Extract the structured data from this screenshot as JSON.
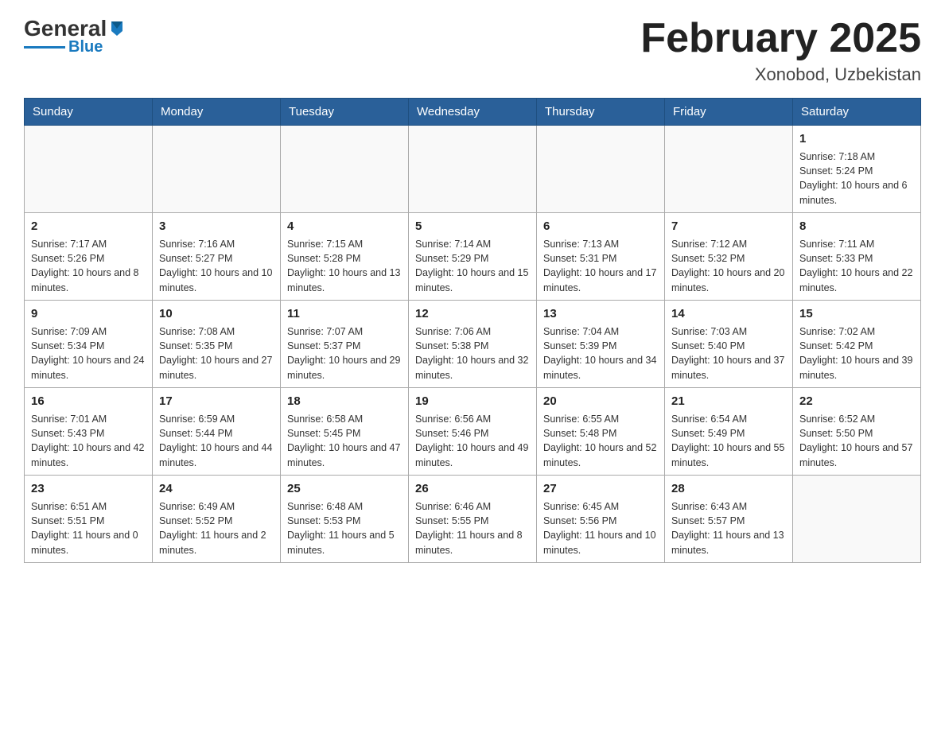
{
  "header": {
    "logo": {
      "general": "General",
      "arrow": "",
      "blue": "Blue"
    },
    "title": "February 2025",
    "subtitle": "Xonobod, Uzbekistan"
  },
  "weekdays": [
    "Sunday",
    "Monday",
    "Tuesday",
    "Wednesday",
    "Thursday",
    "Friday",
    "Saturday"
  ],
  "weeks": [
    [
      {
        "day": "",
        "info": ""
      },
      {
        "day": "",
        "info": ""
      },
      {
        "day": "",
        "info": ""
      },
      {
        "day": "",
        "info": ""
      },
      {
        "day": "",
        "info": ""
      },
      {
        "day": "",
        "info": ""
      },
      {
        "day": "1",
        "info": "Sunrise: 7:18 AM\nSunset: 5:24 PM\nDaylight: 10 hours and 6 minutes."
      }
    ],
    [
      {
        "day": "2",
        "info": "Sunrise: 7:17 AM\nSunset: 5:26 PM\nDaylight: 10 hours and 8 minutes."
      },
      {
        "day": "3",
        "info": "Sunrise: 7:16 AM\nSunset: 5:27 PM\nDaylight: 10 hours and 10 minutes."
      },
      {
        "day": "4",
        "info": "Sunrise: 7:15 AM\nSunset: 5:28 PM\nDaylight: 10 hours and 13 minutes."
      },
      {
        "day": "5",
        "info": "Sunrise: 7:14 AM\nSunset: 5:29 PM\nDaylight: 10 hours and 15 minutes."
      },
      {
        "day": "6",
        "info": "Sunrise: 7:13 AM\nSunset: 5:31 PM\nDaylight: 10 hours and 17 minutes."
      },
      {
        "day": "7",
        "info": "Sunrise: 7:12 AM\nSunset: 5:32 PM\nDaylight: 10 hours and 20 minutes."
      },
      {
        "day": "8",
        "info": "Sunrise: 7:11 AM\nSunset: 5:33 PM\nDaylight: 10 hours and 22 minutes."
      }
    ],
    [
      {
        "day": "9",
        "info": "Sunrise: 7:09 AM\nSunset: 5:34 PM\nDaylight: 10 hours and 24 minutes."
      },
      {
        "day": "10",
        "info": "Sunrise: 7:08 AM\nSunset: 5:35 PM\nDaylight: 10 hours and 27 minutes."
      },
      {
        "day": "11",
        "info": "Sunrise: 7:07 AM\nSunset: 5:37 PM\nDaylight: 10 hours and 29 minutes."
      },
      {
        "day": "12",
        "info": "Sunrise: 7:06 AM\nSunset: 5:38 PM\nDaylight: 10 hours and 32 minutes."
      },
      {
        "day": "13",
        "info": "Sunrise: 7:04 AM\nSunset: 5:39 PM\nDaylight: 10 hours and 34 minutes."
      },
      {
        "day": "14",
        "info": "Sunrise: 7:03 AM\nSunset: 5:40 PM\nDaylight: 10 hours and 37 minutes."
      },
      {
        "day": "15",
        "info": "Sunrise: 7:02 AM\nSunset: 5:42 PM\nDaylight: 10 hours and 39 minutes."
      }
    ],
    [
      {
        "day": "16",
        "info": "Sunrise: 7:01 AM\nSunset: 5:43 PM\nDaylight: 10 hours and 42 minutes."
      },
      {
        "day": "17",
        "info": "Sunrise: 6:59 AM\nSunset: 5:44 PM\nDaylight: 10 hours and 44 minutes."
      },
      {
        "day": "18",
        "info": "Sunrise: 6:58 AM\nSunset: 5:45 PM\nDaylight: 10 hours and 47 minutes."
      },
      {
        "day": "19",
        "info": "Sunrise: 6:56 AM\nSunset: 5:46 PM\nDaylight: 10 hours and 49 minutes."
      },
      {
        "day": "20",
        "info": "Sunrise: 6:55 AM\nSunset: 5:48 PM\nDaylight: 10 hours and 52 minutes."
      },
      {
        "day": "21",
        "info": "Sunrise: 6:54 AM\nSunset: 5:49 PM\nDaylight: 10 hours and 55 minutes."
      },
      {
        "day": "22",
        "info": "Sunrise: 6:52 AM\nSunset: 5:50 PM\nDaylight: 10 hours and 57 minutes."
      }
    ],
    [
      {
        "day": "23",
        "info": "Sunrise: 6:51 AM\nSunset: 5:51 PM\nDaylight: 11 hours and 0 minutes."
      },
      {
        "day": "24",
        "info": "Sunrise: 6:49 AM\nSunset: 5:52 PM\nDaylight: 11 hours and 2 minutes."
      },
      {
        "day": "25",
        "info": "Sunrise: 6:48 AM\nSunset: 5:53 PM\nDaylight: 11 hours and 5 minutes."
      },
      {
        "day": "26",
        "info": "Sunrise: 6:46 AM\nSunset: 5:55 PM\nDaylight: 11 hours and 8 minutes."
      },
      {
        "day": "27",
        "info": "Sunrise: 6:45 AM\nSunset: 5:56 PM\nDaylight: 11 hours and 10 minutes."
      },
      {
        "day": "28",
        "info": "Sunrise: 6:43 AM\nSunset: 5:57 PM\nDaylight: 11 hours and 13 minutes."
      },
      {
        "day": "",
        "info": ""
      }
    ]
  ]
}
